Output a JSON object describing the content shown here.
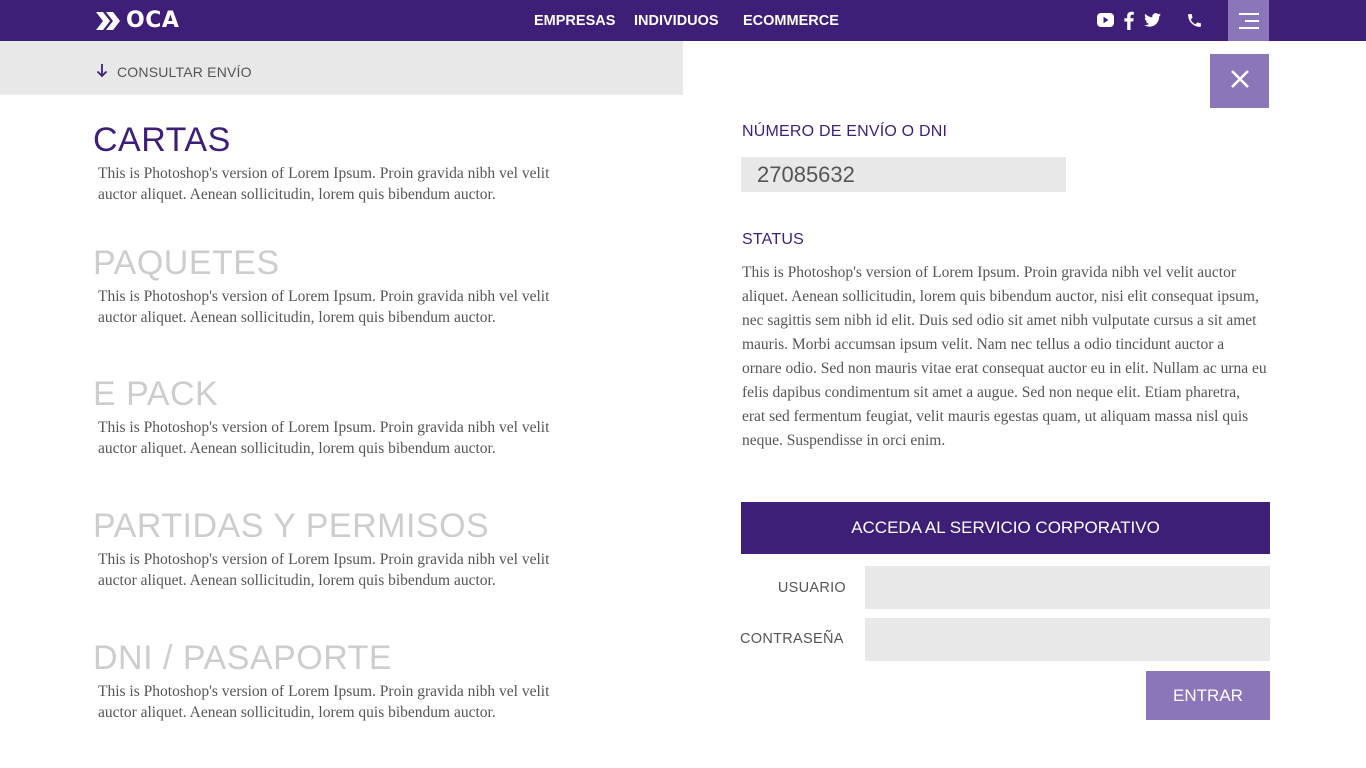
{
  "brand": {
    "name": "OCA",
    "primary_color": "#3d1f78",
    "accent_color": "#8a76b8"
  },
  "nav": {
    "items": [
      {
        "label": "EMPRESAS"
      },
      {
        "label": "INDIVIDUOS"
      },
      {
        "label": "ECOMMERCE"
      }
    ],
    "social_icons": [
      "youtube-icon",
      "facebook-icon",
      "twitter-icon",
      "phone-icon"
    ],
    "menu_icon": "hamburger-menu-icon"
  },
  "consult": {
    "label": "CONSULTAR ENVÍO",
    "icon": "arrow-down-icon"
  },
  "services": [
    {
      "title": "CARTAS",
      "description": "This is Photoshop's version  of Lorem Ipsum. Proin gravida nibh vel velit auctor aliquet. Aenean sollicitudin, lorem quis bibendum auctor.",
      "active": true
    },
    {
      "title": "PAQUETES",
      "description": "This is Photoshop's version  of Lorem Ipsum. Proin gravida nibh vel velit auctor aliquet. Aenean sollicitudin, lorem quis bibendum auctor.",
      "active": false
    },
    {
      "title": "E PACK",
      "description": "This is Photoshop's version  of Lorem Ipsum. Proin gravida nibh vel velit auctor aliquet. Aenean sollicitudin, lorem quis bibendum auctor.",
      "active": false
    },
    {
      "title": "PARTIDAS Y PERMISOS",
      "description": "This is Photoshop's version  of Lorem Ipsum. Proin gravida nibh vel velit auctor aliquet. Aenean sollicitudin, lorem quis bibendum auctor.",
      "active": false
    },
    {
      "title": "DNI / PASAPORTE",
      "description": "This is Photoshop's version  of Lorem Ipsum. Proin gravida nibh vel velit auctor aliquet. Aenean sollicitudin, lorem quis bibendum auctor.",
      "active": false
    }
  ],
  "tracking": {
    "close_icon": "close-icon",
    "number_label": "NÚMERO DE ENVÍO O DNI",
    "number_value": "27085632",
    "status_label": "STATUS",
    "status_text": "This is Photoshop's version  of Lorem Ipsum. Proin gravida nibh vel velit auctor aliquet. Aenean sollicitudin, lorem quis bibendum auctor, nisi elit consequat ipsum, nec sagittis sem nibh id elit. Duis sed odio sit amet nibh vulputate cursus a sit amet mauris. Morbi accumsan ipsum velit. Nam nec tellus a odio tincidunt auctor a ornare odio. Sed non  mauris vitae erat consequat auctor eu in elit. Nullam ac urna eu felis dapibus condimentum sit amet a augue. Sed non neque elit. Etiam pharetra, erat sed fermentum feugiat, velit mauris egestas quam, ut aliquam massa nisl quis neque. Suspendisse in orci enim."
  },
  "corporate": {
    "header": "ACCEDA AL SERVICIO CORPORATIVO",
    "user_label": "USUARIO",
    "user_value": "",
    "password_label": "CONTRASEÑA",
    "password_value": "",
    "submit_label": "ENTRAR"
  }
}
